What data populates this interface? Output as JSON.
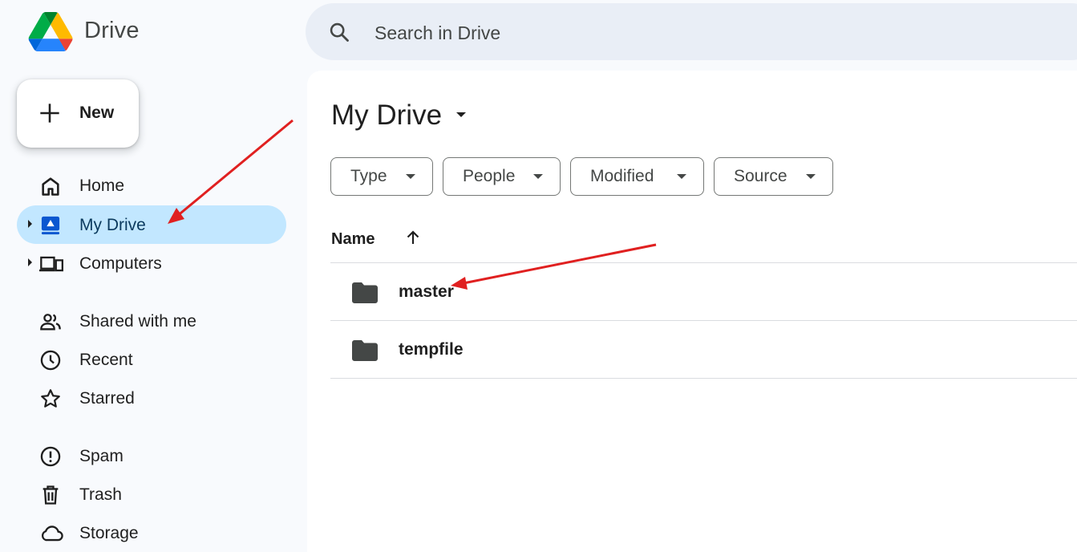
{
  "header": {
    "app_name": "Drive",
    "search_placeholder": "Search in Drive"
  },
  "sidebar": {
    "new_label": "New",
    "items": [
      {
        "label": "Home",
        "icon": "home-icon"
      },
      {
        "label": "My Drive",
        "icon": "my-drive-icon",
        "active": true
      },
      {
        "label": "Computers",
        "icon": "computers-icon"
      },
      {
        "label": "Shared with me",
        "icon": "shared-icon"
      },
      {
        "label": "Recent",
        "icon": "clock-icon"
      },
      {
        "label": "Starred",
        "icon": "star-icon"
      },
      {
        "label": "Spam",
        "icon": "spam-icon"
      },
      {
        "label": "Trash",
        "icon": "trash-icon"
      },
      {
        "label": "Storage",
        "icon": "cloud-icon"
      }
    ]
  },
  "main": {
    "title": "My Drive",
    "filters": [
      "Type",
      "People",
      "Modified",
      "Source"
    ],
    "column_name": "Name",
    "files": [
      {
        "name": "master",
        "icon": "folder-icon"
      },
      {
        "name": "tempfile",
        "icon": "folder-icon"
      }
    ]
  },
  "colors": {
    "active_nav": "#c2e7ff",
    "search_bg": "#e9eef6",
    "annotation_arrow": "#e02020"
  }
}
